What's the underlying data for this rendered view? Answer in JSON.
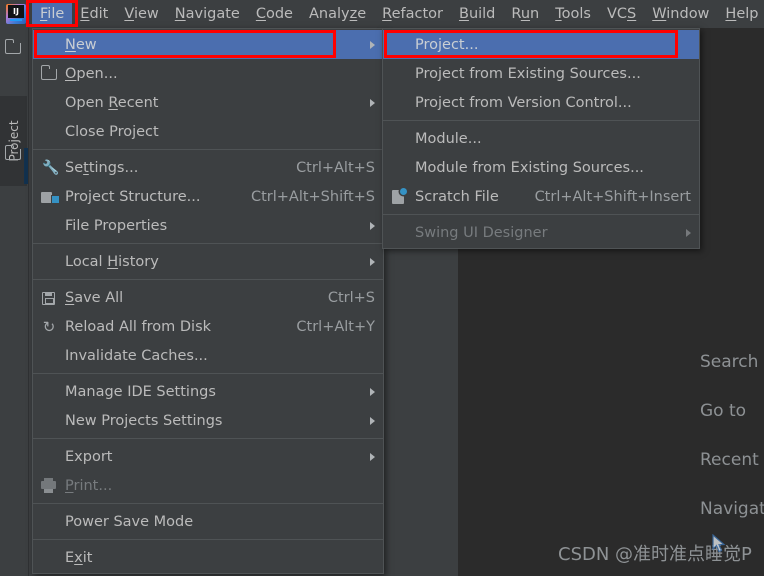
{
  "app": {
    "logo_icon": "intellij-idea-logo",
    "background_editor_color": "#2b2b2b",
    "background_panel_color": "#3c3f41",
    "accent_highlight_color": "#4b6eaf",
    "annotation_color": "#ff0000"
  },
  "menubar": {
    "items": [
      {
        "label": "File",
        "mnemonic": "F",
        "active": true
      },
      {
        "label": "Edit",
        "mnemonic": "E",
        "active": false
      },
      {
        "label": "View",
        "mnemonic": "V",
        "active": false
      },
      {
        "label": "Navigate",
        "mnemonic": "N",
        "active": false
      },
      {
        "label": "Code",
        "mnemonic": "C",
        "active": false
      },
      {
        "label": "Analyze",
        "mnemonic": "z",
        "active": false
      },
      {
        "label": "Refactor",
        "mnemonic": "R",
        "active": false
      },
      {
        "label": "Build",
        "mnemonic": "B",
        "active": false
      },
      {
        "label": "Run",
        "mnemonic": "u",
        "active": false
      },
      {
        "label": "Tools",
        "mnemonic": "T",
        "active": false
      },
      {
        "label": "VCS",
        "mnemonic": "S",
        "active": false
      },
      {
        "label": "Window",
        "mnemonic": "W",
        "active": false
      },
      {
        "label": "Help",
        "mnemonic": "H",
        "active": false
      }
    ]
  },
  "sidebar": {
    "project_tab_label": "Project",
    "top_icon": "folder-icon",
    "bottom_icon": "folder-icon"
  },
  "file_menu": {
    "items": [
      {
        "label": "New",
        "icon": "",
        "accel": "",
        "arrow": true,
        "selected": true,
        "disabled": false
      },
      {
        "label": "Open...",
        "icon": "folder-icon",
        "accel": "",
        "arrow": false,
        "selected": false,
        "disabled": false
      },
      {
        "label": "Open Recent",
        "icon": "",
        "accel": "",
        "arrow": true,
        "selected": false,
        "disabled": false
      },
      {
        "label": "Close Project",
        "icon": "",
        "accel": "",
        "arrow": false,
        "selected": false,
        "disabled": false
      },
      {
        "separator": true
      },
      {
        "label": "Settings...",
        "icon": "wrench-icon",
        "accel": "Ctrl+Alt+S",
        "arrow": false,
        "selected": false,
        "disabled": false
      },
      {
        "label": "Project Structure...",
        "icon": "project-structure-icon",
        "accel": "Ctrl+Alt+Shift+S",
        "arrow": false,
        "selected": false,
        "disabled": false
      },
      {
        "label": "File Properties",
        "icon": "",
        "accel": "",
        "arrow": true,
        "selected": false,
        "disabled": false
      },
      {
        "separator": true
      },
      {
        "label": "Local History",
        "icon": "",
        "accel": "",
        "arrow": true,
        "selected": false,
        "disabled": false
      },
      {
        "separator": true
      },
      {
        "label": "Save All",
        "icon": "save-icon",
        "accel": "Ctrl+S",
        "arrow": false,
        "selected": false,
        "disabled": false
      },
      {
        "label": "Reload All from Disk",
        "icon": "reload-icon",
        "accel": "Ctrl+Alt+Y",
        "arrow": false,
        "selected": false,
        "disabled": false
      },
      {
        "label": "Invalidate Caches...",
        "icon": "",
        "accel": "",
        "arrow": false,
        "selected": false,
        "disabled": false
      },
      {
        "separator": true
      },
      {
        "label": "Manage IDE Settings",
        "icon": "",
        "accel": "",
        "arrow": true,
        "selected": false,
        "disabled": false
      },
      {
        "label": "New Projects Settings",
        "icon": "",
        "accel": "",
        "arrow": true,
        "selected": false,
        "disabled": false
      },
      {
        "separator": true
      },
      {
        "label": "Export",
        "icon": "",
        "accel": "",
        "arrow": true,
        "selected": false,
        "disabled": false
      },
      {
        "label": "Print...",
        "icon": "print-icon",
        "accel": "",
        "arrow": false,
        "selected": false,
        "disabled": true
      },
      {
        "separator": true
      },
      {
        "label": "Power Save Mode",
        "icon": "",
        "accel": "",
        "arrow": false,
        "selected": false,
        "disabled": false
      },
      {
        "separator": true
      },
      {
        "label": "Exit",
        "icon": "",
        "accel": "",
        "arrow": false,
        "selected": false,
        "disabled": false
      }
    ]
  },
  "new_submenu": {
    "items": [
      {
        "label": "Project...",
        "icon": "",
        "accel": "",
        "arrow": false,
        "selected": true,
        "disabled": false
      },
      {
        "label": "Project from Existing Sources...",
        "icon": "",
        "accel": "",
        "arrow": false,
        "selected": false,
        "disabled": false
      },
      {
        "label": "Project from Version Control...",
        "icon": "",
        "accel": "",
        "arrow": false,
        "selected": false,
        "disabled": false
      },
      {
        "separator": true
      },
      {
        "label": "Module...",
        "icon": "",
        "accel": "",
        "arrow": false,
        "selected": false,
        "disabled": false
      },
      {
        "label": "Module from Existing Sources...",
        "icon": "",
        "accel": "",
        "arrow": false,
        "selected": false,
        "disabled": false
      },
      {
        "label": "Scratch File",
        "icon": "scratch-file-icon",
        "accel": "Ctrl+Alt+Shift+Insert",
        "arrow": false,
        "selected": false,
        "disabled": false
      },
      {
        "separator": true
      },
      {
        "label": "Swing UI Designer",
        "icon": "",
        "accel": "",
        "arrow": true,
        "selected": false,
        "disabled": true
      }
    ]
  },
  "welcome_hints": {
    "lines": [
      "Search",
      "Go to",
      "Recent",
      "Navigate"
    ]
  },
  "watermark": {
    "text": "CSDN @准时准点睡觉P",
    "cursor_icon": "mouse-pointer-icon",
    "cursor_glyph": "⌖"
  }
}
